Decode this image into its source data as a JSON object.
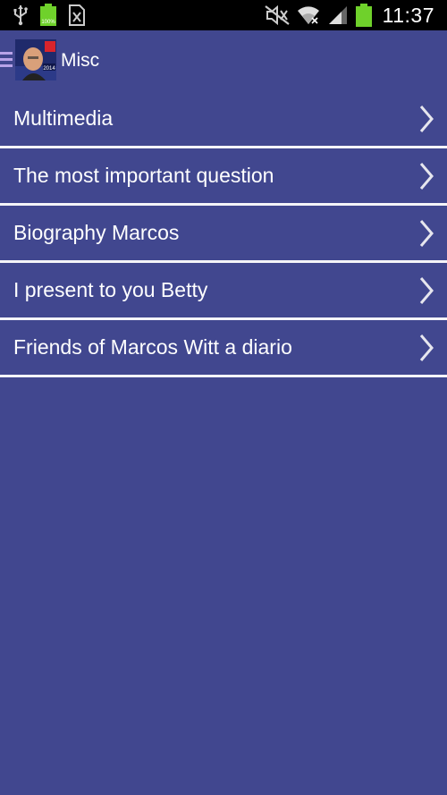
{
  "status_bar": {
    "time": "11:37",
    "battery_text": "100%",
    "icons": [
      "usb-icon",
      "battery-icon",
      "sim-icon",
      "mute-icon",
      "wifi-icon",
      "signal-icon",
      "battery-full-icon"
    ]
  },
  "action_bar": {
    "title": "Misc",
    "avatar_badge": "2014"
  },
  "menu": {
    "items": [
      {
        "label": "Multimedia"
      },
      {
        "label": "The most important question"
      },
      {
        "label": "Biography Marcos"
      },
      {
        "label": "I present to you Betty"
      },
      {
        "label": "Friends of Marcos Witt a diario"
      }
    ]
  },
  "colors": {
    "background": "#41478f",
    "divider": "#f4f4f8",
    "status_bar": "#000000",
    "battery_green": "#6fd12b",
    "drawer_icon": "#b8a3e8"
  }
}
